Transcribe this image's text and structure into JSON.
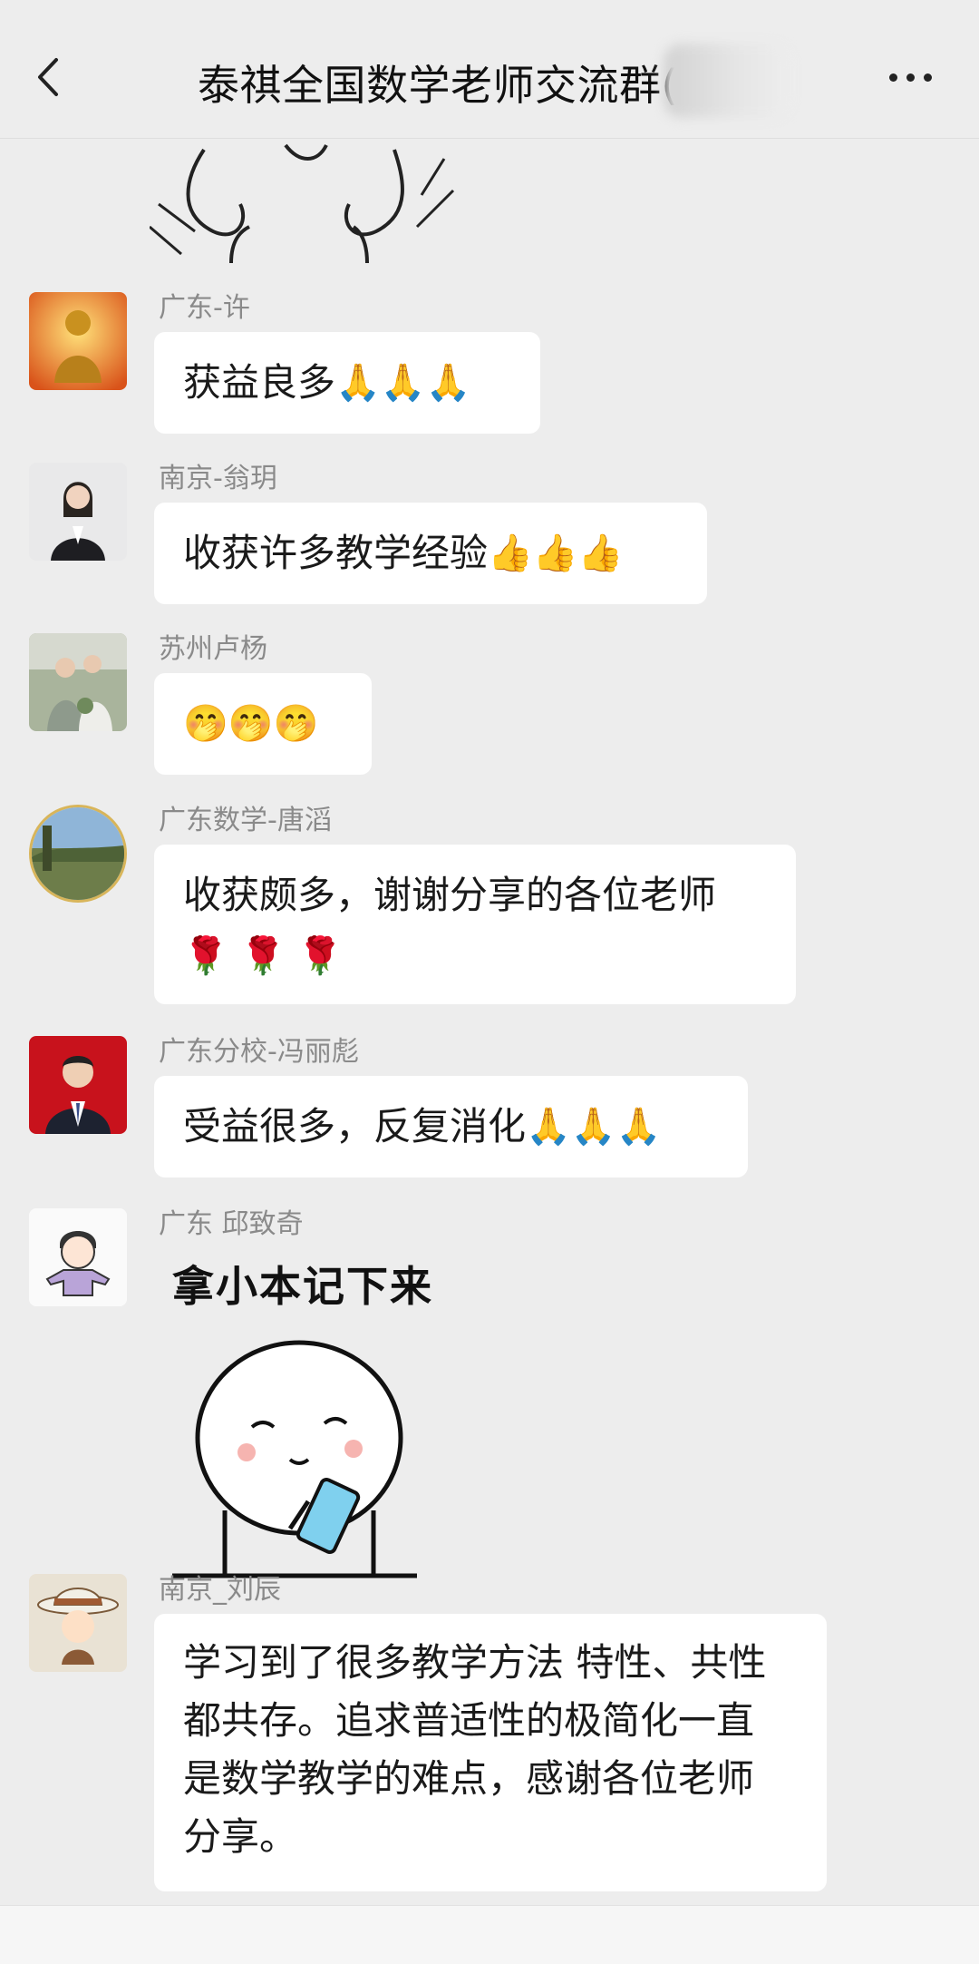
{
  "header": {
    "title": "泰祺全国数学老师交流群("
  },
  "messages": [
    {
      "sender": "广东-许",
      "text": "获益良多",
      "emoji": [
        "🙏",
        "🙏",
        "🙏"
      ],
      "avatar": "buddha-avatar"
    },
    {
      "sender": "南京-翁玥",
      "text": "收获许多教学经验",
      "emoji": [
        "👍",
        "👍",
        "👍"
      ],
      "avatar": "woman-portrait-avatar"
    },
    {
      "sender": "苏州卢杨",
      "text": "",
      "emoji": [
        "🤭",
        "🤭",
        "🤭"
      ],
      "avatar": "couple-photo-avatar"
    },
    {
      "sender": "广东数学-唐滔",
      "line1": "收获颇多，谢谢分享的各位老师",
      "emoji": [
        "🌹",
        "🌹",
        "🌹"
      ],
      "avatar": "landscape-avatar"
    },
    {
      "sender": "广东分校-冯丽彪",
      "text": "受益很多，反复消化",
      "emoji": [
        "🙏",
        "🙏",
        "🙏"
      ],
      "avatar": "man-portrait-avatar"
    },
    {
      "sender": "广东 邱致奇",
      "sticker_caption": "拿小本记下来",
      "avatar": "cartoon-boy-avatar"
    },
    {
      "sender": "南京_刘辰",
      "lines": [
        "学习到了很多教学方法 特性、共性",
        "都共存。追求普适性的极简化一直",
        "是数学教学的难点，感谢各位老师",
        "分享。"
      ],
      "avatar": "detective-cartoon-avatar"
    }
  ],
  "colors": {
    "background": "#ededed",
    "bubble": "#ffffff",
    "sender": "#8a8a8a"
  }
}
